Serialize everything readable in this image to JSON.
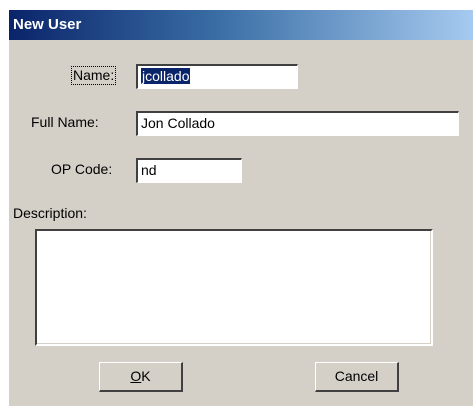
{
  "window": {
    "title": "New User"
  },
  "form": {
    "name_label": "Name:",
    "name_value": "jcollado",
    "fullname_label": "Full Name:",
    "fullname_value": "Jon Collado",
    "opcode_label": "OP Code:",
    "opcode_value": "nd",
    "description_label": "Description:",
    "description_value": ""
  },
  "buttons": {
    "ok_label": "OK",
    "ok_mnemonic": "O",
    "ok_rest": "K",
    "cancel_label": "Cancel"
  },
  "colors": {
    "dialog_bg": "#d4d0c8",
    "title_start": "#0a246a",
    "title_end": "#a6caf0",
    "selection": "#0a246a"
  }
}
